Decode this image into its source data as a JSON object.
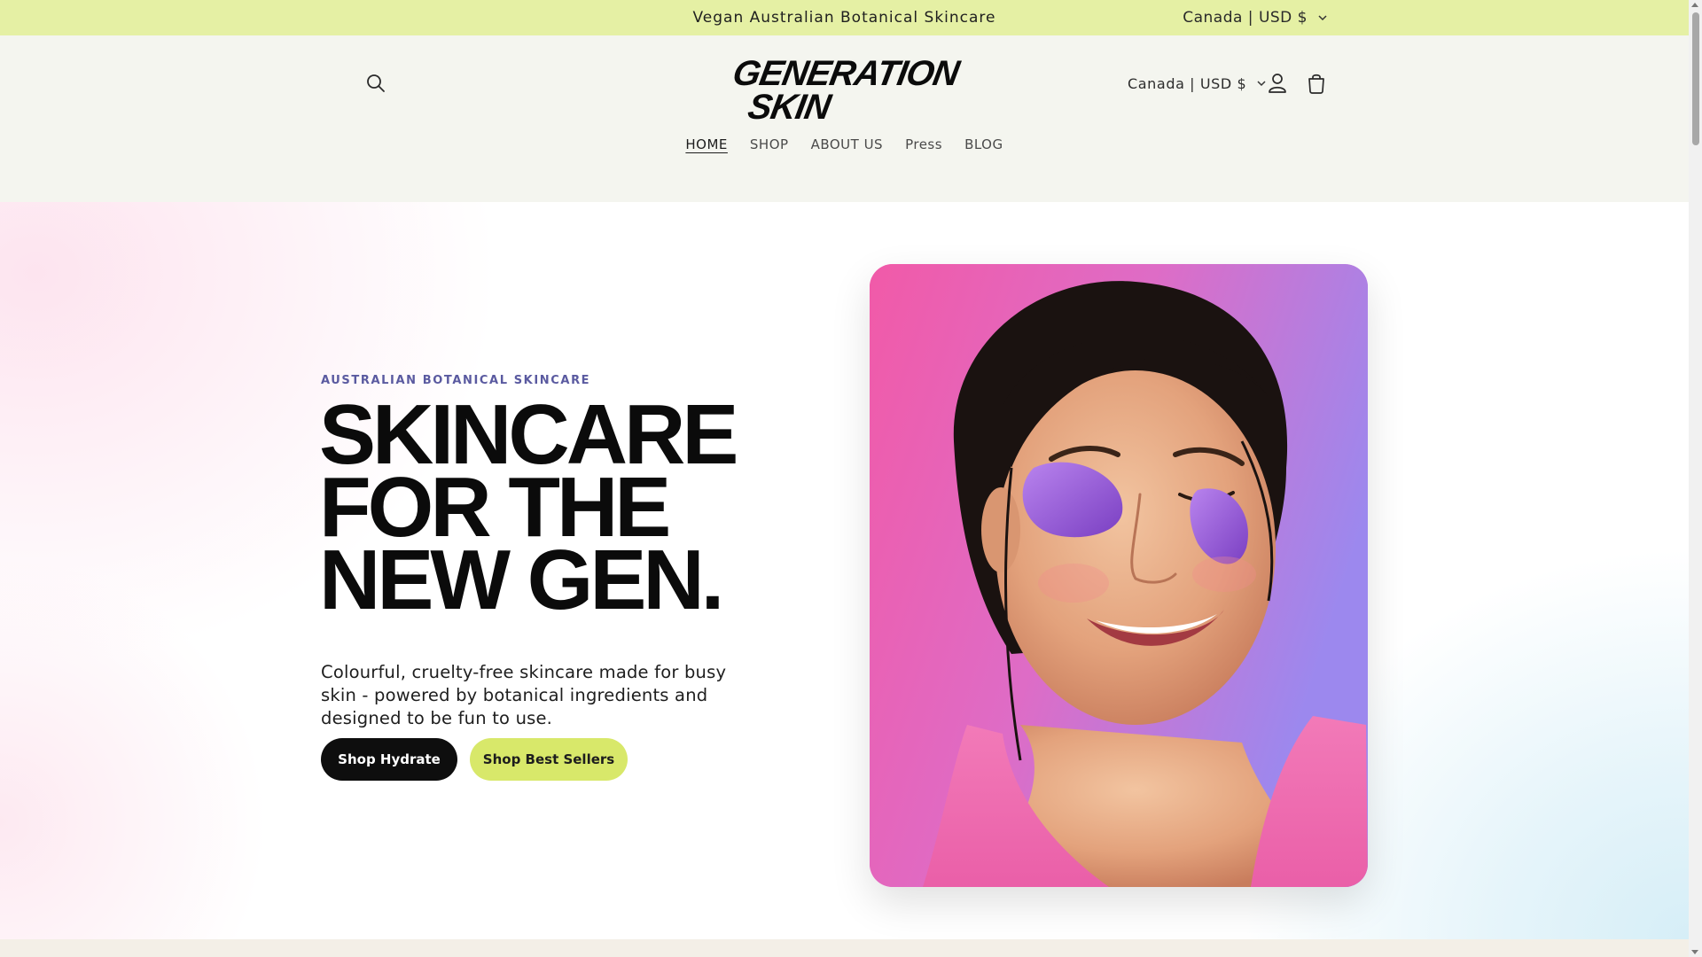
{
  "announcement": {
    "text": "Vegan Australian Botanical Skincare",
    "currency": "Canada | USD $"
  },
  "header": {
    "logo_line1": "GENERATION",
    "logo_line2": "SKIN",
    "currency": "Canada | USD $",
    "icons": {
      "search": "search-icon",
      "account": "user-icon",
      "cart": "cart-icon"
    }
  },
  "nav": {
    "items": [
      {
        "label": "HOME",
        "active": true
      },
      {
        "label": "SHOP"
      },
      {
        "label": "ABOUT US"
      },
      {
        "label": "Press"
      },
      {
        "label": "BLOG"
      }
    ]
  },
  "hero": {
    "eyebrow": "AUSTRALIAN BOTANICAL SKINCARE",
    "headline": [
      "SKINCARE",
      "FOR THE",
      "NEW GEN."
    ],
    "subcopy": "Colourful, cruelty-free skincare made for busy skin - powered by botanical ingredients and designed to be fun to use.",
    "primary_cta": "Shop Hydrate",
    "secondary_cta": "Shop Best Sellers"
  },
  "colors": {
    "announcement_bg": "#e5f0a4",
    "header_bg": "#f4f5ef",
    "primary_button": "#0e0e0e",
    "secondary_button": "#d8e86a",
    "eyebrow": "#5a5aa0"
  }
}
